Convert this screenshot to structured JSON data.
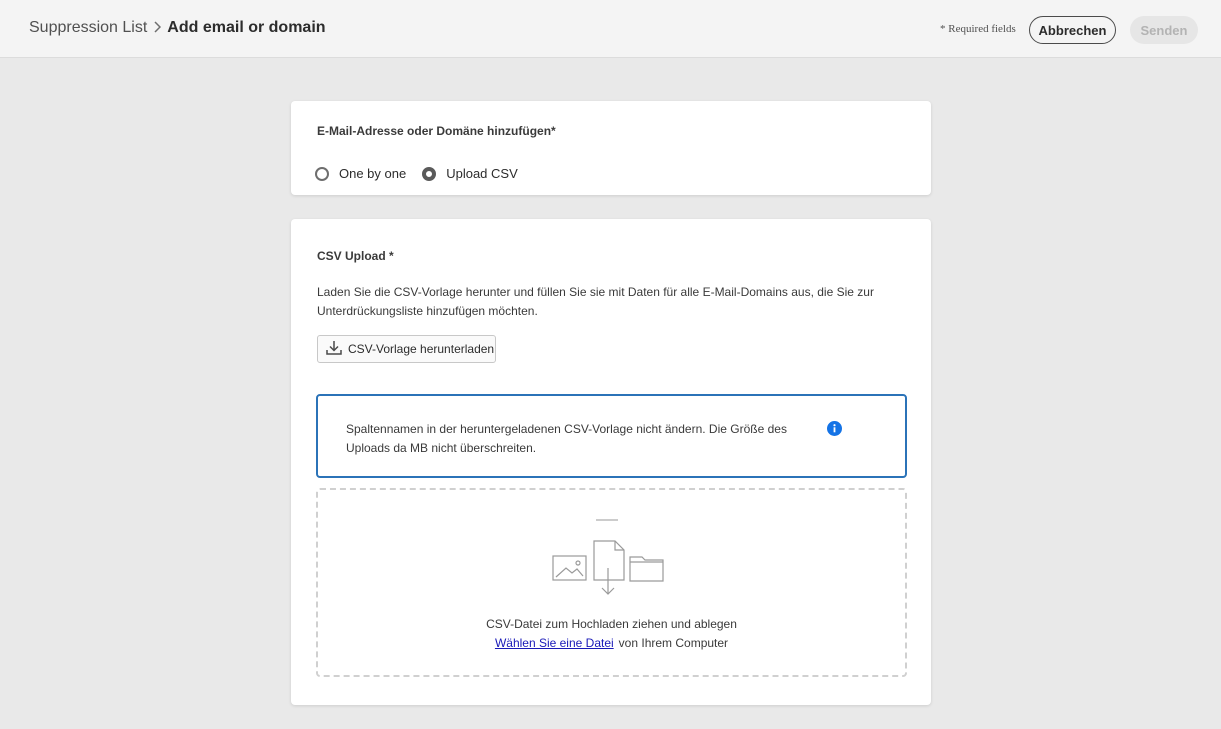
{
  "header": {
    "breadcrumb_parent": "Suppression List",
    "breadcrumb_current": "Add email or domain",
    "required_note": "* Required fields",
    "cancel_label": "Abbrechen",
    "send_label": "Senden"
  },
  "type_section": {
    "label": "E-Mail-Adresse oder Domäne hinzufügen*",
    "options": [
      {
        "label": "One by one",
        "selected": false
      },
      {
        "label": "Upload CSV",
        "selected": true
      }
    ]
  },
  "csv_section": {
    "label": "CSV Upload *",
    "description": "Laden Sie die CSV-Vorlage herunter und füllen Sie sie mit Daten für alle E-Mail-Domains aus, die Sie zur Unterdrückungsliste hinzufügen möchten.",
    "download_label": "CSV-Vorlage herunterladen",
    "info_text": "Spaltennamen in der heruntergeladenen CSV-Vorlage nicht ändern. Die Größe des Uploads da MB nicht überschreiten.",
    "drop_text": "CSV-Datei zum Hochladen ziehen und ablegen",
    "choose_file_link": "Wählen Sie eine Datei",
    "from_computer": "von Ihrem Computer"
  },
  "colors": {
    "accent_blue": "#2b73b8",
    "info_icon": "#1473e6",
    "link": "#1a1ab8"
  },
  "icons": {
    "breadcrumb_separator": "chevron-right-icon",
    "download": "download-icon",
    "info": "info-icon",
    "dropzone": "upload-illustration"
  }
}
